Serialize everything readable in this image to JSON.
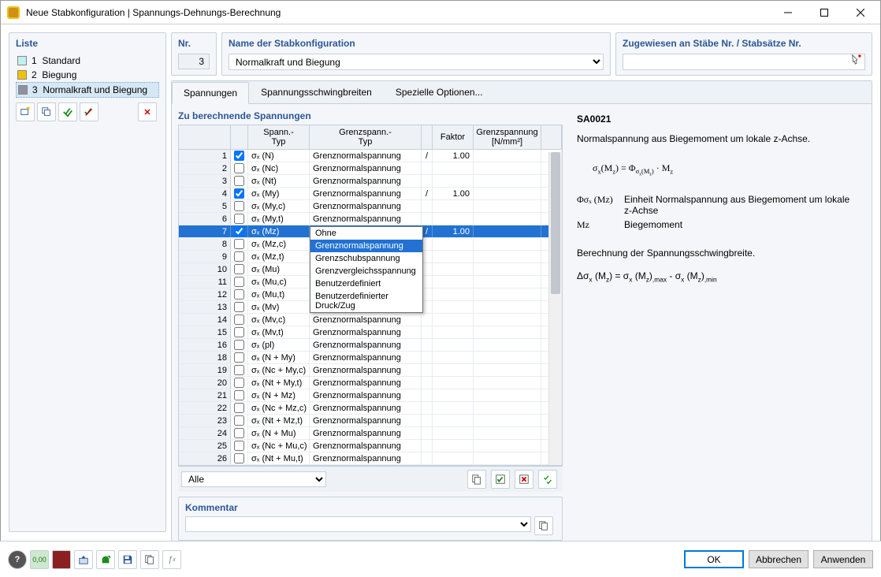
{
  "window": {
    "title": "Neue Stabkonfiguration | Spannungs-Dehnungs-Berechnung"
  },
  "liste": {
    "title": "Liste",
    "items": [
      {
        "num": "1",
        "name": "Standard",
        "color": "#c1f0f0"
      },
      {
        "num": "2",
        "name": "Biegung",
        "color": "#f2c200"
      },
      {
        "num": "3",
        "name": "Normalkraft und Biegung",
        "color": "#9090a0"
      }
    ],
    "selected": 2
  },
  "nr": {
    "title": "Nr.",
    "value": "3"
  },
  "config_name": {
    "title": "Name der Stabkonfiguration",
    "value": "Normalkraft und Biegung"
  },
  "assigned": {
    "title": "Zugewiesen an Stäbe Nr. / Stabsätze Nr."
  },
  "tabs": {
    "stress": "Spannungen",
    "ranges": "Spannungsschwingbreiten",
    "special": "Spezielle Optionen..."
  },
  "grid": {
    "title": "Zu berechnende Spannungen",
    "headers": {
      "typ": "Spann.-\nTyp",
      "gtyp": "Grenzspann.-\nTyp",
      "faktor": "Faktor",
      "grenz": "Grenzspannung\n[N/mm²]"
    },
    "filter": "Alle",
    "rows": [
      {
        "n": "1",
        "chk": true,
        "typ": "σₓ (N)",
        "gtyp": "Grenznormalspannung",
        "div": "/",
        "fak": "1.00",
        "gsp": ""
      },
      {
        "n": "2",
        "chk": false,
        "typ": "σₓ (Nc)",
        "gtyp": "Grenznormalspannung",
        "div": "",
        "fak": "",
        "gsp": ""
      },
      {
        "n": "3",
        "chk": false,
        "typ": "σₓ (Nt)",
        "gtyp": "Grenznormalspannung",
        "div": "",
        "fak": "",
        "gsp": ""
      },
      {
        "n": "4",
        "chk": true,
        "typ": "σₓ (My)",
        "gtyp": "Grenznormalspannung",
        "div": "/",
        "fak": "1.00",
        "gsp": ""
      },
      {
        "n": "5",
        "chk": false,
        "typ": "σₓ (My,c)",
        "gtyp": "Grenznormalspannung",
        "div": "",
        "fak": "",
        "gsp": ""
      },
      {
        "n": "6",
        "chk": false,
        "typ": "σₓ (My,t)",
        "gtyp": "Grenznormalspannung",
        "div": "",
        "fak": "",
        "gsp": ""
      },
      {
        "n": "7",
        "chk": true,
        "typ": "σₓ (Mz)",
        "gtyp": "Grenznormalspannung",
        "div": "/",
        "fak": "1.00",
        "gsp": "",
        "selected": true,
        "combo": true
      },
      {
        "n": "8",
        "chk": false,
        "typ": "σₓ (Mz,c)",
        "gtyp": "",
        "div": "",
        "fak": "",
        "gsp": ""
      },
      {
        "n": "9",
        "chk": false,
        "typ": "σₓ (Mz,t)",
        "gtyp": "",
        "div": "",
        "fak": "",
        "gsp": ""
      },
      {
        "n": "10",
        "chk": false,
        "typ": "σₓ (Mu)",
        "gtyp": "",
        "div": "",
        "fak": "",
        "gsp": ""
      },
      {
        "n": "11",
        "chk": false,
        "typ": "σₓ (Mu,c)",
        "gtyp": "",
        "div": "",
        "fak": "",
        "gsp": ""
      },
      {
        "n": "12",
        "chk": false,
        "typ": "σₓ (Mu,t)",
        "gtyp": "",
        "div": "",
        "fak": "",
        "gsp": ""
      },
      {
        "n": "13",
        "chk": false,
        "typ": "σₓ (Mv)",
        "gtyp": "",
        "div": "",
        "fak": "",
        "gsp": ""
      },
      {
        "n": "14",
        "chk": false,
        "typ": "σₓ (Mv,c)",
        "gtyp": "Grenznormalspannung",
        "div": "",
        "fak": "",
        "gsp": ""
      },
      {
        "n": "15",
        "chk": false,
        "typ": "σₓ (Mv,t)",
        "gtyp": "Grenznormalspannung",
        "div": "",
        "fak": "",
        "gsp": ""
      },
      {
        "n": "16",
        "chk": false,
        "typ": "σₓ (pl)",
        "gtyp": "Grenznormalspannung",
        "div": "",
        "fak": "",
        "gsp": ""
      },
      {
        "n": "18",
        "chk": false,
        "typ": "σₓ (N + My)",
        "gtyp": "Grenznormalspannung",
        "div": "",
        "fak": "",
        "gsp": ""
      },
      {
        "n": "19",
        "chk": false,
        "typ": "σₓ (Nc + My,c)",
        "gtyp": "Grenznormalspannung",
        "div": "",
        "fak": "",
        "gsp": ""
      },
      {
        "n": "20",
        "chk": false,
        "typ": "σₓ (Nt + My,t)",
        "gtyp": "Grenznormalspannung",
        "div": "",
        "fak": "",
        "gsp": ""
      },
      {
        "n": "21",
        "chk": false,
        "typ": "σₓ (N + Mz)",
        "gtyp": "Grenznormalspannung",
        "div": "",
        "fak": "",
        "gsp": ""
      },
      {
        "n": "22",
        "chk": false,
        "typ": "σₓ (Nc + Mz,c)",
        "gtyp": "Grenznormalspannung",
        "div": "",
        "fak": "",
        "gsp": ""
      },
      {
        "n": "23",
        "chk": false,
        "typ": "σₓ (Nt + Mz,t)",
        "gtyp": "Grenznormalspannung",
        "div": "",
        "fak": "",
        "gsp": ""
      },
      {
        "n": "24",
        "chk": false,
        "typ": "σₓ (N + Mu)",
        "gtyp": "Grenznormalspannung",
        "div": "",
        "fak": "",
        "gsp": ""
      },
      {
        "n": "25",
        "chk": false,
        "typ": "σₓ (Nc + Mu,c)",
        "gtyp": "Grenznormalspannung",
        "div": "",
        "fak": "",
        "gsp": ""
      },
      {
        "n": "26",
        "chk": false,
        "typ": "σₓ (Nt + Mu,t)",
        "gtyp": "Grenznormalspannung",
        "div": "",
        "fak": "",
        "gsp": ""
      }
    ]
  },
  "dropdown": {
    "options": [
      "Ohne",
      "Grenznormalspannung",
      "Grenzschubspannung",
      "Grenzvergleichsspannung",
      "Benutzerdefiniert",
      "Benutzerdefinierter Druck/Zug"
    ],
    "selected": 1
  },
  "comment": {
    "title": "Kommentar"
  },
  "info": {
    "code": "SA0021",
    "desc": "Normalspannung aus Biegemoment um lokale z-Achse.",
    "formula": "σₓ(Mz) = Φσₓ(Mz) · Mz",
    "symbols": [
      {
        "sym": "Φσₓ (Mz)",
        "txt": "Einheit Normalspannung aus Biegemoment um lokale z-Achse"
      },
      {
        "sym": "Mz",
        "txt": "Biegemoment"
      }
    ],
    "range_title": "Berechnung der Spannungsschwingbreite.",
    "range_formula": "Δσₓ (Mz) = σₓ (Mz),max - σₓ (Mz),min"
  },
  "buttons": {
    "ok": "OK",
    "cancel": "Abbrechen",
    "apply": "Anwenden"
  }
}
